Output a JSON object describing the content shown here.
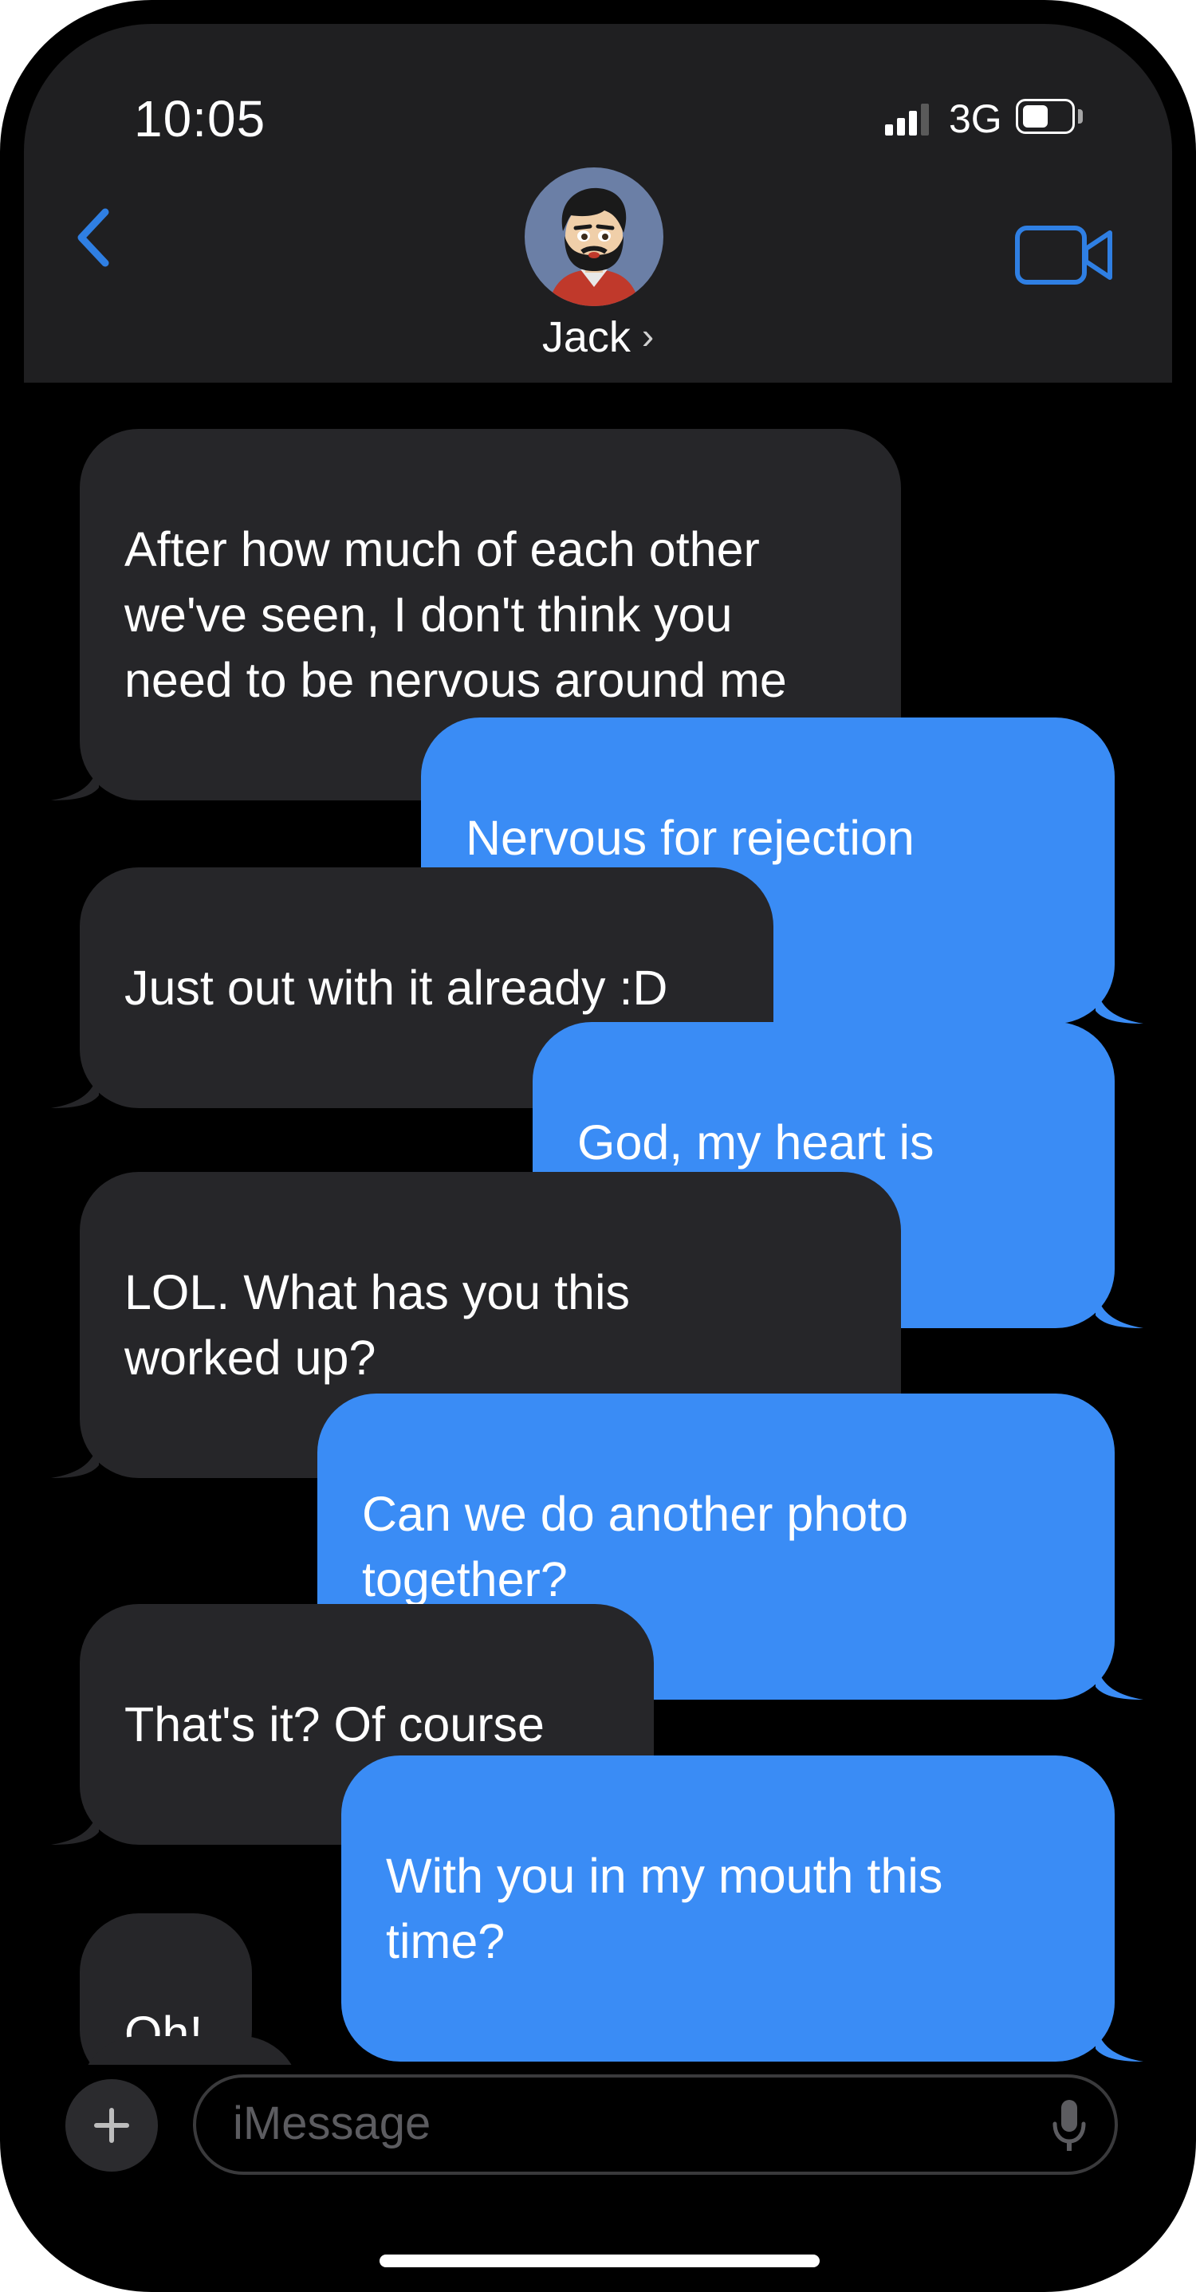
{
  "status_bar": {
    "time": "10:05",
    "network": "3G",
    "battery_level": 0.55
  },
  "header": {
    "contact_name": "Jack",
    "back_icon": "chevron-left-icon",
    "video_icon": "video-camera-icon",
    "accent_color": "#2f7fe3"
  },
  "messages": [
    {
      "side": "in",
      "text": "After how much of each other\nwe've seen, I don't think you\nneed to be nervous around me"
    },
    {
      "side": "out",
      "text": "Nervous for rejection maybe"
    },
    {
      "side": "in",
      "text": "Just out with it already :D"
    },
    {
      "side": "out",
      "text": "God, my heart is racing"
    },
    {
      "side": "in",
      "text": "LOL.  What has you this\nworked up?"
    },
    {
      "side": "out",
      "text": "Can we do another photo\ntogether?"
    },
    {
      "side": "in",
      "text": "That's it?  Of course"
    },
    {
      "side": "out",
      "text": "With you in my mouth this time?"
    },
    {
      "side": "in",
      "text": "Oh!"
    }
  ],
  "composer": {
    "placeholder": "iMessage",
    "plus_icon": "plus-icon",
    "mic_icon": "microphone-icon"
  },
  "colors": {
    "incoming_bubble": "#262629",
    "outgoing_bubble": "#3a8cf5",
    "header_bg": "#1f1f21"
  }
}
